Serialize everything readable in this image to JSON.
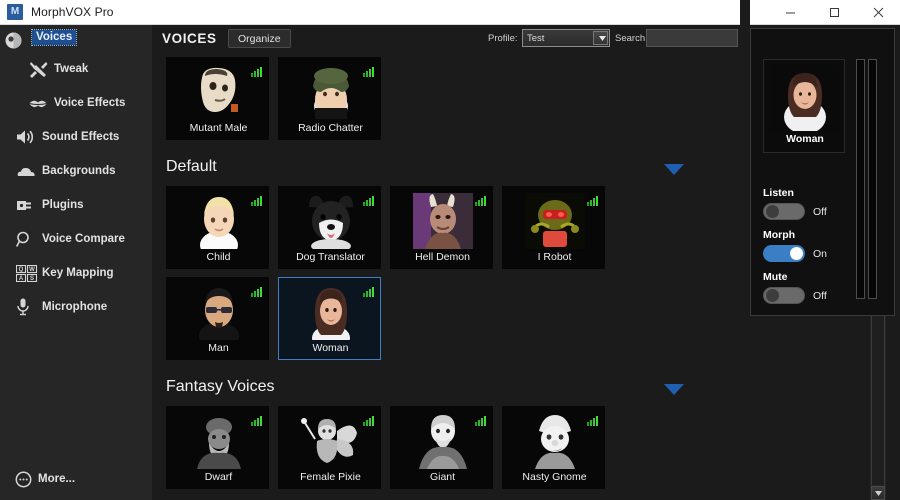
{
  "window": {
    "title": "MorphVOX Pro",
    "app_icon": "app-logo-icon",
    "minimize_label": "–",
    "maximize_label": "☐",
    "close_label": "×"
  },
  "sidebar": {
    "selected": "Voices",
    "top_item": {
      "label": "Voices",
      "icon": "voices-icon"
    },
    "items": [
      {
        "label": "Tweak",
        "icon": "tools-icon",
        "sub": true
      },
      {
        "label": "Voice Effects",
        "icon": "lips-icon",
        "sub": true
      },
      {
        "label": "Sound Effects",
        "icon": "speaker-icon",
        "sub": false
      },
      {
        "label": "Backgrounds",
        "icon": "cloud-icon",
        "sub": false
      },
      {
        "label": "Plugins",
        "icon": "plug-icon",
        "sub": false
      },
      {
        "label": "Voice Compare",
        "icon": "magnifier-icon",
        "sub": false
      },
      {
        "label": "Key Mapping",
        "icon": "keyboard-icon",
        "sub": false
      },
      {
        "label": "Microphone",
        "icon": "microphone-icon",
        "sub": false
      }
    ],
    "more": {
      "label": "More...",
      "icon": "more-ellipsis-icon"
    }
  },
  "main": {
    "title": "VOICES",
    "organize_label": "Organize",
    "profile_label": "Profile:",
    "profile_value": "Test",
    "search_label": "Search",
    "search_value": "",
    "search_placeholder": "",
    "sections": [
      {
        "title": "",
        "chevron": false,
        "rows": [
          [
            {
              "name": "Mutant Male",
              "selected": false,
              "art": "mutant-male"
            },
            {
              "name": "Radio Chatter",
              "selected": false,
              "art": "radio-chatter"
            }
          ]
        ]
      },
      {
        "title": "Default",
        "chevron": true,
        "rows": [
          [
            {
              "name": "Child",
              "selected": false,
              "art": "child"
            },
            {
              "name": "Dog Translator",
              "selected": false,
              "art": "dog"
            },
            {
              "name": "Hell Demon",
              "selected": false,
              "art": "demon"
            },
            {
              "name": "I Robot",
              "selected": false,
              "art": "robot"
            }
          ],
          [
            {
              "name": "Man",
              "selected": false,
              "art": "man"
            },
            {
              "name": "Woman",
              "selected": true,
              "art": "woman"
            }
          ]
        ]
      },
      {
        "title": "Fantasy Voices",
        "chevron": true,
        "rows": [
          [
            {
              "name": "Dwarf",
              "selected": false,
              "art": "dwarf"
            },
            {
              "name": "Female Pixie",
              "selected": false,
              "art": "pixie"
            },
            {
              "name": "Giant",
              "selected": false,
              "art": "giant"
            },
            {
              "name": "Nasty Gnome",
              "selected": false,
              "art": "gnome"
            }
          ]
        ]
      }
    ]
  },
  "right_panel": {
    "preview_name": "Woman",
    "controls": [
      {
        "label": "Listen",
        "state": "Off",
        "on": false
      },
      {
        "label": "Morph",
        "state": "On",
        "on": true
      },
      {
        "label": "Mute",
        "state": "Off",
        "on": false
      }
    ],
    "meters": 2
  },
  "colors": {
    "accent_blue": "#3a7fc4",
    "selection_blue": "#1d4f91",
    "chevron_blue": "#1f5fb0",
    "indicator_green": "#2eb82e",
    "panel_bg": "#1b1b1b",
    "sidebar_bg": "#262626",
    "tile_bg": "#070707"
  }
}
